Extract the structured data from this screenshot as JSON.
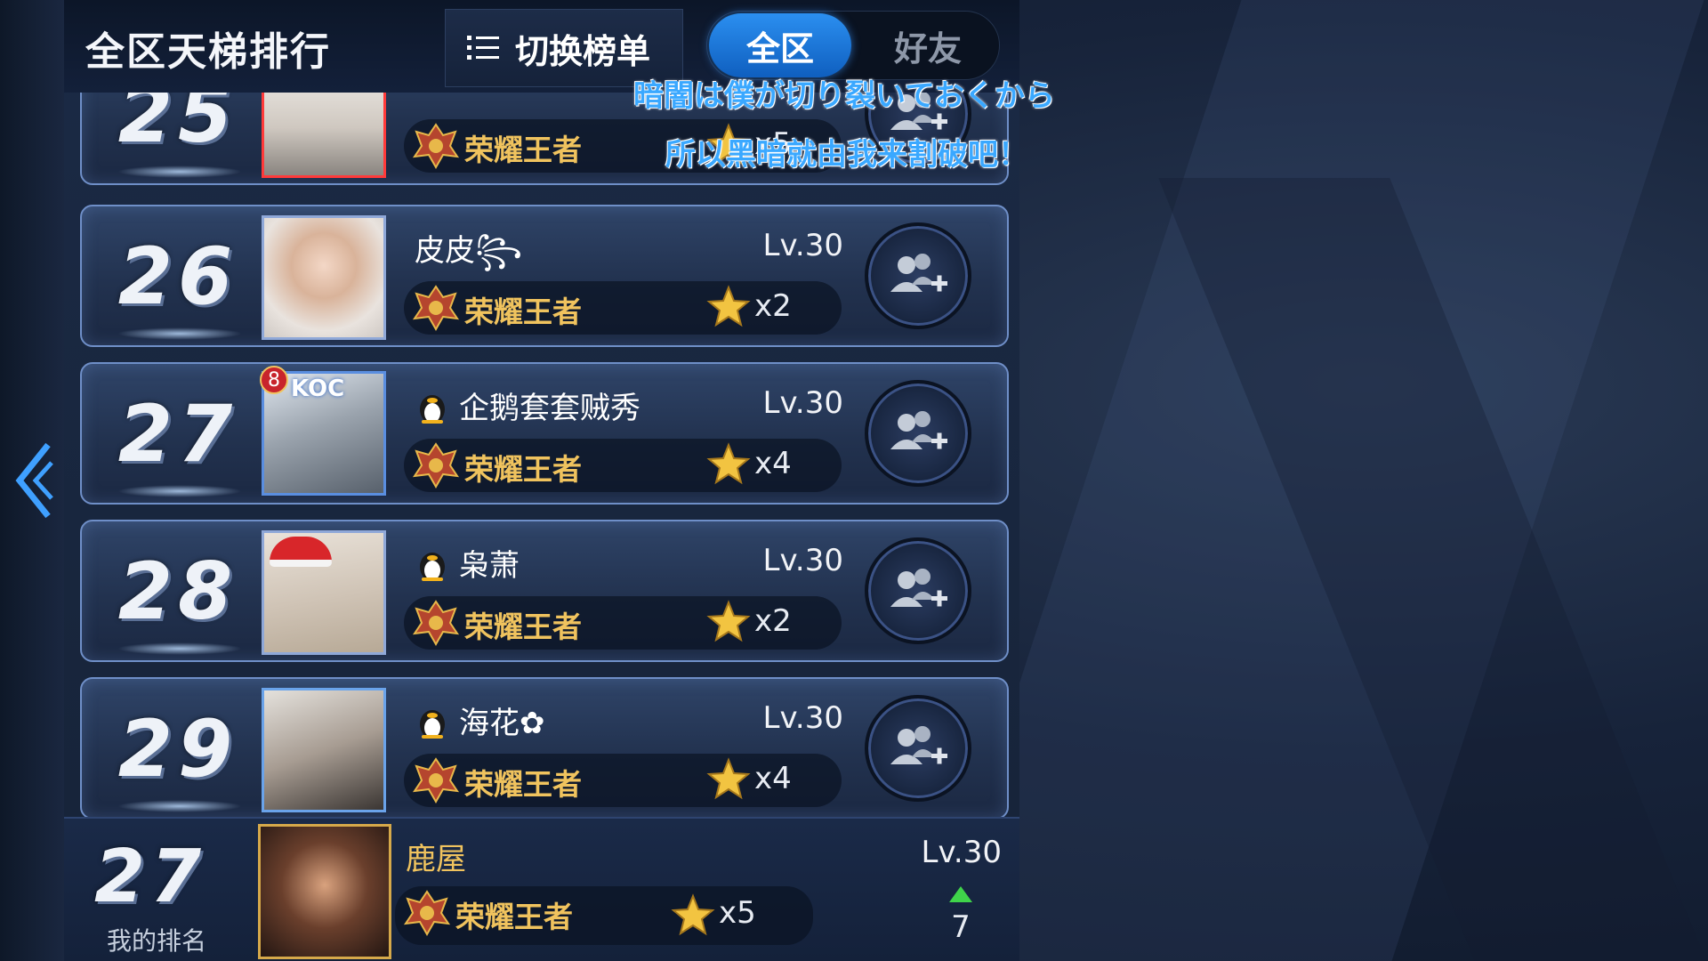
{
  "header": {
    "title": "全区天梯排行",
    "switch_label": "切换榜单",
    "tabs": [
      {
        "label": "全区",
        "active": true
      },
      {
        "label": "好友",
        "active": false
      }
    ]
  },
  "subtitles": {
    "line1": "暗闇は僕が切り裂いておくから",
    "line2": "所以黑暗就由我来割破吧！"
  },
  "rows": [
    {
      "rank": "25",
      "name": "",
      "level": "",
      "tier": "荣耀王者",
      "stars": "x5"
    },
    {
      "rank": "26",
      "name": "皮皮꧂",
      "level": "Lv.30",
      "tier": "荣耀王者",
      "stars": "x2",
      "penguin": false
    },
    {
      "rank": "27",
      "name": "企鹅套套贼秀",
      "level": "Lv.30",
      "tier": "荣耀王者",
      "stars": "x4",
      "penguin": true,
      "badge": "8",
      "frame_text": "KOC"
    },
    {
      "rank": "28",
      "name": "枭萧",
      "level": "Lv.30",
      "tier": "荣耀王者",
      "stars": "x2",
      "penguin": true
    },
    {
      "rank": "29",
      "name": "海花✿",
      "level": "Lv.30",
      "tier": "荣耀王者",
      "stars": "x4",
      "penguin": true
    }
  ],
  "my_rank": {
    "rank": "27",
    "label": "我的排名",
    "name": "鹿屋",
    "level": "Lv.30",
    "tier": "荣耀王者",
    "stars": "x5",
    "trend": "7",
    "trend_direction": "up"
  },
  "colors": {
    "accent": "#2b8ff0",
    "tier_gold": "#f0c35e",
    "subtitle_blue": "#3aa8ff",
    "trend_green": "#3fd34a"
  },
  "icons": {
    "back": "chevron-left-icon",
    "list": "list-icon",
    "add_friend": "add-friend-icon",
    "star": "star-icon",
    "tier": "king-emblem-icon",
    "penguin": "penguin-icon"
  }
}
